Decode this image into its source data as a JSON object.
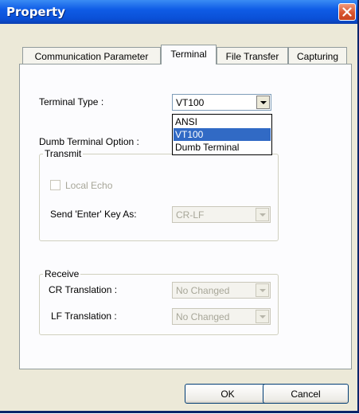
{
  "window": {
    "title": "Property"
  },
  "tabs": [
    {
      "label": "Communication Parameter",
      "active": false
    },
    {
      "label": "Terminal",
      "active": true
    },
    {
      "label": "File Transfer",
      "active": false
    },
    {
      "label": "Capturing",
      "active": false
    }
  ],
  "terminal": {
    "terminal_type_label": "Terminal Type :",
    "terminal_type_value": "VT100",
    "terminal_type_options": [
      "ANSI",
      "VT100",
      "Dumb Terminal"
    ],
    "selected_option": "VT100",
    "dumb_option_label": "Dumb Terminal Option :",
    "transmit": {
      "caption": "Transmit",
      "local_echo_label": "Local Echo",
      "local_echo_checked": false,
      "send_enter_label": "Send 'Enter' Key  As:",
      "send_enter_value": "CR-LF"
    },
    "receive": {
      "caption": "Receive",
      "cr_label": "CR Translation :",
      "cr_value": "No Changed",
      "lf_label": "LF Translation :",
      "lf_value": "No Changed"
    }
  },
  "buttons": {
    "ok": "OK",
    "cancel": "Cancel"
  },
  "colors": {
    "titlebar": "#0a4fd6",
    "close_button": "#d9552f",
    "selection": "#316ac5",
    "window_bg": "#ece9d8",
    "disabled_text": "#a7a698"
  },
  "icons": {
    "close": "close-x-icon",
    "dropdown": "chevron-down-icon"
  }
}
